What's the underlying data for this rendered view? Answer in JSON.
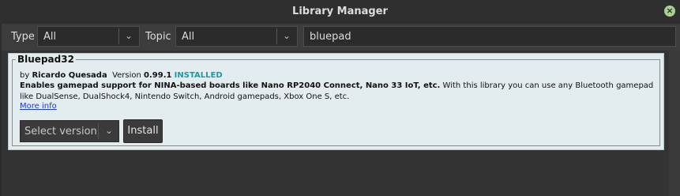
{
  "window": {
    "title": "Library Manager",
    "close_icon": "×"
  },
  "filters": {
    "type_label": "Type",
    "type_value": "All",
    "topic_label": "Topic",
    "topic_value": "All",
    "search_value": "bluepad"
  },
  "library": {
    "name": "Bluepad32",
    "by_prefix": "by",
    "author": "Ricardo Quesada",
    "version_label": "Version",
    "version": "0.99.1",
    "status": "INSTALLED",
    "summary_bold": "Enables gamepad support for NINA-based boards like Nano RP2040 Connect, Nano 33 IoT, etc.",
    "summary_rest": "With this library you can use any Bluetooth gamepad",
    "summary_line2": "like DualSense, DualShock4, Nintendo Switch, Android gamepads, Xbox One S, etc.",
    "more_info": "More info",
    "select_version": "Select version",
    "install": "Install"
  },
  "colors": {
    "installed": "#1a9aa8",
    "link": "#1a3cc8",
    "card_bg": "#e3ecef"
  }
}
